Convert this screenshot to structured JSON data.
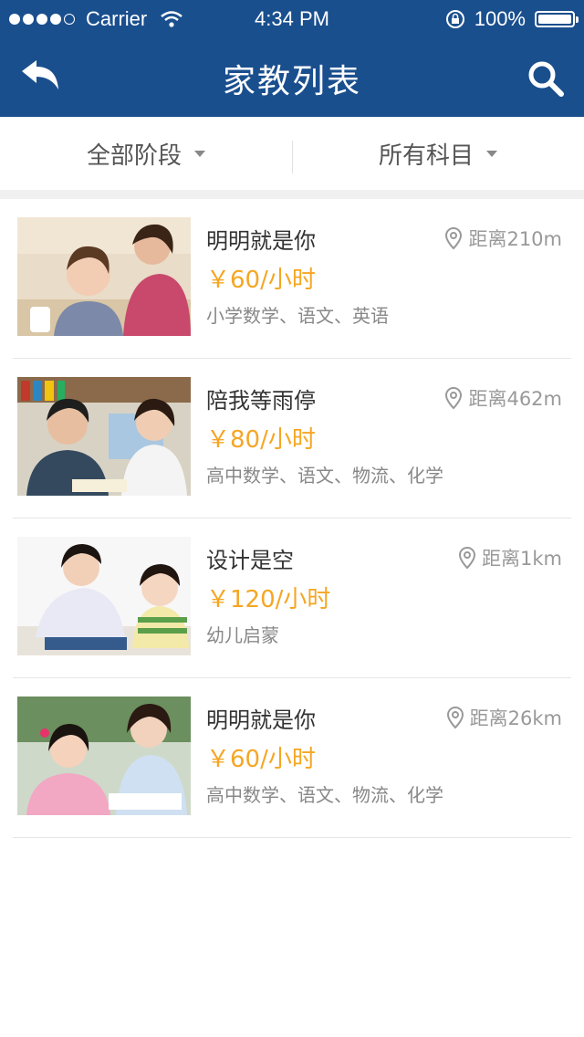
{
  "status_bar": {
    "carrier": "Carrier",
    "time": "4:34 PM",
    "battery": "100%",
    "battery_level": 1.0
  },
  "nav": {
    "title": "家教列表",
    "back_icon": "back-arrow-icon",
    "search_icon": "search-icon"
  },
  "filters": [
    {
      "label": "全部阶段",
      "icon": "caret-down-icon"
    },
    {
      "label": "所有科目",
      "icon": "caret-down-icon"
    }
  ],
  "tutors": [
    {
      "name": "明明就是你",
      "price": "￥60/小时",
      "subjects": "小学数学、语文、英语",
      "distance": "距离210m"
    },
    {
      "name": "陪我等雨停",
      "price": "￥80/小时",
      "subjects": "高中数学、语文、物流、化学",
      "distance": "距离462m"
    },
    {
      "name": "设计是空",
      "price": "￥120/小时",
      "subjects": "幼儿启蒙",
      "distance": "距离1km"
    },
    {
      "name": "明明就是你",
      "price": "￥60/小时",
      "subjects": "高中数学、语文、物流、化学",
      "distance": "距离26km"
    }
  ],
  "colors": {
    "header": "#1a4f8e",
    "price": "#f5a623",
    "text": "#333333",
    "muted": "#888888"
  }
}
